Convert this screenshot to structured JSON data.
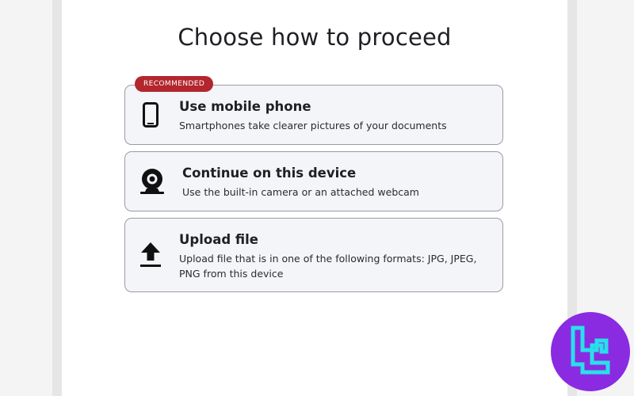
{
  "page": {
    "title": "Choose how to proceed"
  },
  "options": [
    {
      "badge": "RECOMMENDED",
      "icon": "smartphone-icon",
      "title": "Use mobile phone",
      "description": "Smartphones take clearer pictures of your documents"
    },
    {
      "icon": "webcam-icon",
      "title": "Continue on this device",
      "description": "Use the built-in camera or an attached webcam"
    },
    {
      "icon": "upload-icon",
      "title": "Upload file",
      "description": "Upload file that is in one of the following formats: JPG, JPEG, PNG from this device"
    }
  ],
  "colors": {
    "badge": "#b3262e",
    "card_background": "#f4f5f9",
    "card_border": "#9a9ca3",
    "logo_background": "#8a2be2",
    "logo_stroke": "#28e0e8"
  }
}
